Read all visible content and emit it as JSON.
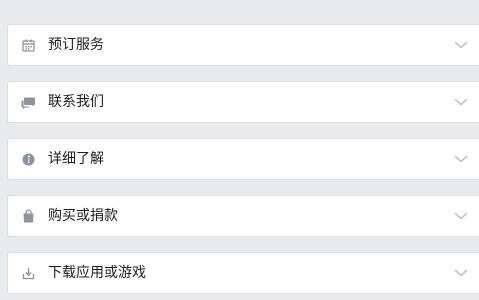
{
  "menu": {
    "items": [
      {
        "id": "book",
        "label": "预订服务",
        "icon": "calendar-icon"
      },
      {
        "id": "contact",
        "label": "联系我们",
        "icon": "chat-bubbles-icon"
      },
      {
        "id": "learn",
        "label": "详细了解",
        "icon": "info-icon"
      },
      {
        "id": "buy",
        "label": "购买或捐款",
        "icon": "shopping-bag-icon"
      },
      {
        "id": "download",
        "label": "下载应用或游戏",
        "icon": "download-icon"
      }
    ]
  },
  "colors": {
    "background": "#e9eaed",
    "row_background": "#ffffff",
    "border": "#dddfe2",
    "text": "#1c1e21",
    "icon": "#8d949e",
    "chevron": "#bec3c9"
  }
}
